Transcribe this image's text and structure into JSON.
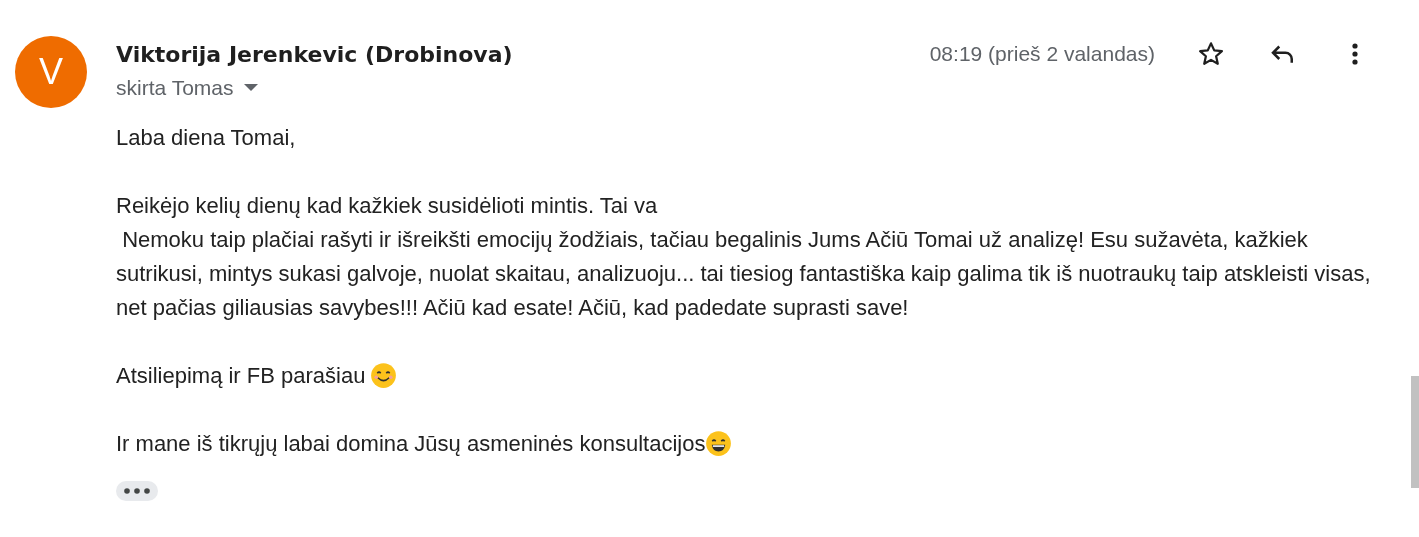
{
  "message": {
    "avatar_letter": "V",
    "sender": "Viktorija Jerenkevic (Drobinova)",
    "recipient": "skirta Tomas",
    "time": "08:19 (prieš 2 valandas)",
    "starred": false,
    "body": [
      {
        "kind": "plain",
        "text": "Laba diena Tomai,"
      },
      {
        "kind": "plain",
        "text": "Reikėjo kelių dienų kad kažkiek susidėlioti mintis. Tai va\n Nemoku taip plačiai rašyti ir išreikšti emocijų žodžiais, tačiau begalinis Jums Ačiū Tomai už analizę! Esu sužavėta, kažkiek sutrikusi, mintys sukasi galvoje, nuolat skaitau, analizuoju... tai tiesiog fantastiška kaip galima tik iš nuotraukų taip atskleisti visas, net pačias giliausias savybes!!! Ačiū kad esate! Ačiū, kad padedate suprasti save!"
      },
      {
        "kind": "smile",
        "text": "Atsiliepimą ir FB parašiau"
      },
      {
        "kind": "grin",
        "text": "Ir mane iš tikrųjų labai domina Jūsų asmeninės konsultacijos"
      }
    ]
  }
}
